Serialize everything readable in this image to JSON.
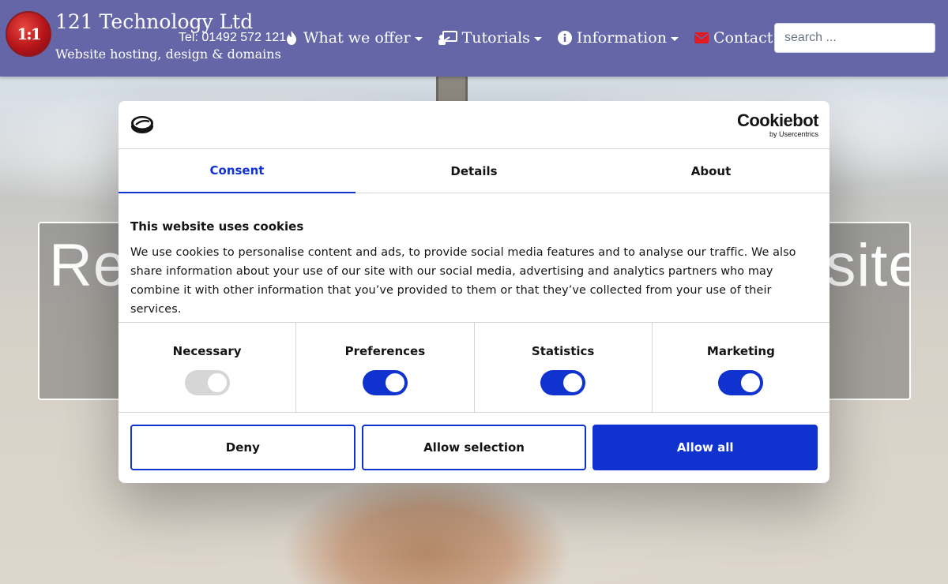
{
  "header": {
    "brand_name": "121 Technology Ltd",
    "tagline": "Website hosting, design & domains",
    "phone": "Tel: 01492 572 121",
    "logo_text": "1:1",
    "background_color": "#6566a8"
  },
  "nav": {
    "items": [
      {
        "label": "What we offer",
        "icon": "fire-icon",
        "has_dropdown": true
      },
      {
        "label": "Tutorials",
        "icon": "presentation-icon",
        "has_dropdown": true
      },
      {
        "label": "Information",
        "icon": "info-icon",
        "has_dropdown": true
      },
      {
        "label": "Contact",
        "icon": "envelope-icon",
        "has_dropdown": false
      }
    ]
  },
  "search": {
    "placeholder": "search ...",
    "value": ""
  },
  "hero": {
    "heading_left": "Re",
    "heading_right": "site"
  },
  "cookie_dialog": {
    "brand": "Cookiebot",
    "brand_sub": "by Usercentrics",
    "tabs": [
      {
        "label": "Consent",
        "active": true
      },
      {
        "label": "Details",
        "active": false
      },
      {
        "label": "About",
        "active": false
      }
    ],
    "title": "This website uses cookies",
    "text": "We use cookies to personalise content and ads, to provide social media features and to analyse our traffic. We also share information about your use of our site with our social media, advertising and analytics partners who may combine it with other information that you’ve provided to them or that they’ve collected from your use of their services.",
    "categories": [
      {
        "label": "Necessary",
        "enabled": true,
        "locked": true
      },
      {
        "label": "Preferences",
        "enabled": true,
        "locked": false
      },
      {
        "label": "Statistics",
        "enabled": true,
        "locked": false
      },
      {
        "label": "Marketing",
        "enabled": true,
        "locked": false
      }
    ],
    "buttons": {
      "deny": "Deny",
      "allow_selection": "Allow selection",
      "allow_all": "Allow all"
    },
    "accent_color": "#1032cf"
  }
}
